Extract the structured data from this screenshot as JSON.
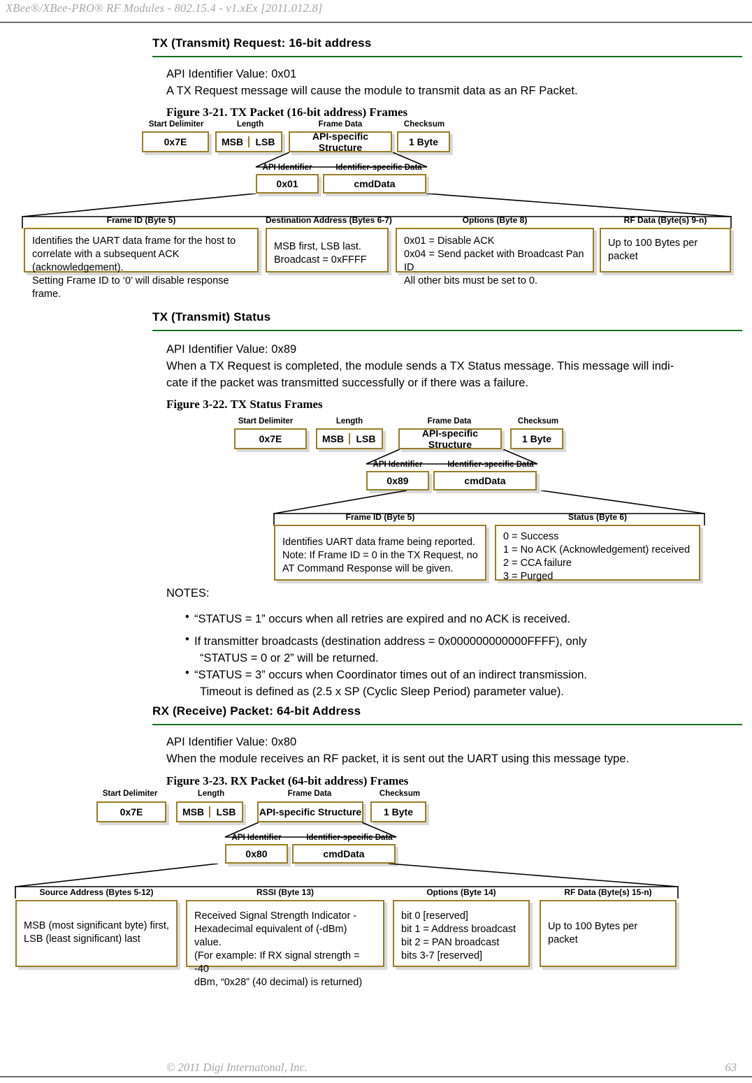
{
  "page": {
    "header": "XBee®/XBee-PRO®  RF Modules - 802.15.4 - v1.xEx [2011.012.8]",
    "footer_copyright": "© 2011 Digi Internatonal, Inc.",
    "page_number": "63"
  },
  "sections": [
    {
      "title": "TX (Transmit) Request: 16-bit address",
      "api_line": "API Identifier Value: 0x01",
      "description": "A TX Request message will cause the module to transmit data as an RF Packet."
    },
    {
      "title": "TX (Transmit) Status",
      "api_line": "API Identifier Value: 0x89",
      "description_line1": "When a TX Request is completed, the module sends a TX Status message. This message will indi-",
      "description_line2": "cate if the packet was transmitted successfully or if there was a failure."
    },
    {
      "title": "RX (Receive) Packet: 64-bit Address",
      "api_line": "API Identifier Value: 0x80",
      "description": "When the module receives an RF packet, it is sent out the UART using this message type."
    }
  ],
  "figures": {
    "fig21": {
      "caption": "Figure 3-21.  TX Packet (16-bit address) Frames",
      "labels": {
        "start_delimiter": "Start Delimiter",
        "length": "Length",
        "frame_data": "Frame Data",
        "checksum": "Checksum",
        "api_identifier": "API Identifier",
        "identifier_specific_data": "Identifier-specific Data"
      },
      "boxes": {
        "start_delimiter": "0x7E",
        "msb": "MSB",
        "lsb": "LSB",
        "frame_data": "API-specific Structure",
        "checksum": "1 Byte",
        "api_identifier": "0x01",
        "identifier_specific_data": "cmdData"
      },
      "details": [
        {
          "head": "Frame ID (Byte 5)",
          "lines": [
            "Identifies the UART data frame for the host to",
            "correlate with a subsequent ACK (acknowledgement).",
            "Setting Frame ID to ‘0’ will disable response frame."
          ]
        },
        {
          "head": "Destination Address (Bytes 6-7)",
          "lines": [
            "MSB first, LSB last.",
            "Broadcast = 0xFFFF"
          ]
        },
        {
          "head": "Options (Byte 8)",
          "lines": [
            "0x01 = Disable ACK",
            "0x04 = Send packet with Broadcast Pan ID",
            "All other bits must be set to 0."
          ]
        },
        {
          "head": "RF Data (Byte(s) 9-n)",
          "lines": [
            "Up to 100 Bytes per packet"
          ]
        }
      ]
    },
    "fig22": {
      "caption": "Figure 3-22.  TX Status Frames",
      "labels": {
        "start_delimiter": "Start Delimiter",
        "length": "Length",
        "frame_data": "Frame Data",
        "checksum": "Checksum",
        "api_identifier": "API Identifier",
        "identifier_specific_data": "Identifier-specific Data"
      },
      "boxes": {
        "start_delimiter": "0x7E",
        "msb": "MSB",
        "lsb": "LSB",
        "frame_data": "API-specific Structure",
        "checksum": "1 Byte",
        "api_identifier": "0x89",
        "identifier_specific_data": "cmdData"
      },
      "details": [
        {
          "head": "Frame ID (Byte 5)",
          "lines": [
            "Identifies UART data frame being reported.",
            "Note: If Frame ID = 0 in the TX Request, no",
            "AT Command Response will be given."
          ]
        },
        {
          "head": "Status (Byte 6)",
          "lines": [
            "0 = Success",
            "1 = No ACK (Acknowledgement) received",
            "2 = CCA failure",
            "3 = Purged"
          ]
        }
      ]
    },
    "fig23": {
      "caption": "Figure 3-23.  RX Packet (64-bit address) Frames",
      "labels": {
        "start_delimiter": "Start Delimiter",
        "length": "Length",
        "frame_data": "Frame Data",
        "checksum": "Checksum",
        "api_identifier": "API Identifier",
        "identifier_specific_data": "Identifier-specific Data"
      },
      "boxes": {
        "start_delimiter": "0x7E",
        "msb": "MSB",
        "lsb": "LSB",
        "frame_data": "API-specific Structure",
        "checksum": "1 Byte",
        "api_identifier": "0x80",
        "identifier_specific_data": "cmdData"
      },
      "details": [
        {
          "head": "Source Address (Bytes 5-12)",
          "lines": [
            "MSB (most significant byte) first,",
            "LSB (least significant) last"
          ]
        },
        {
          "head": "RSSI (Byte 13)",
          "lines": [
            "Received Signal Strength Indicator -",
            "Hexadecimal equivalent of (-dBm) value.",
            "(For example: If RX signal strength = -40",
            "dBm, “0x28” (40 decimal) is returned)"
          ]
        },
        {
          "head": "Options (Byte 14)",
          "lines": [
            "bit 0 [reserved]",
            "bit 1 = Address broadcast",
            "bit 2 = PAN broadcast",
            "bits 3-7 [reserved]"
          ]
        },
        {
          "head": "RF Data (Byte(s) 15-n)",
          "lines": [
            "Up to 100 Bytes per packet"
          ]
        }
      ]
    }
  },
  "notes": {
    "label": "NOTES:",
    "bullet": "•",
    "items": [
      {
        "lines": [
          "“STATUS = 1” occurs when all retries are expired and no ACK is received."
        ]
      },
      {
        "lines": [
          "If transmitter broadcasts (destination address = 0x000000000000FFFF), only",
          "“STATUS = 0 or 2” will be returned."
        ]
      },
      {
        "lines": [
          "“STATUS = 3” occurs when Coordinator times out of an indirect transmission.",
          "Timeout is defined as (2.5 x SP (Cyclic Sleep Period) parameter value)."
        ]
      }
    ]
  },
  "colors": {
    "box_border": "#9a7d26",
    "heading_rule": "#14711f",
    "page_rule": "#6b6b6b",
    "muted_text": "#a6a6a6"
  }
}
